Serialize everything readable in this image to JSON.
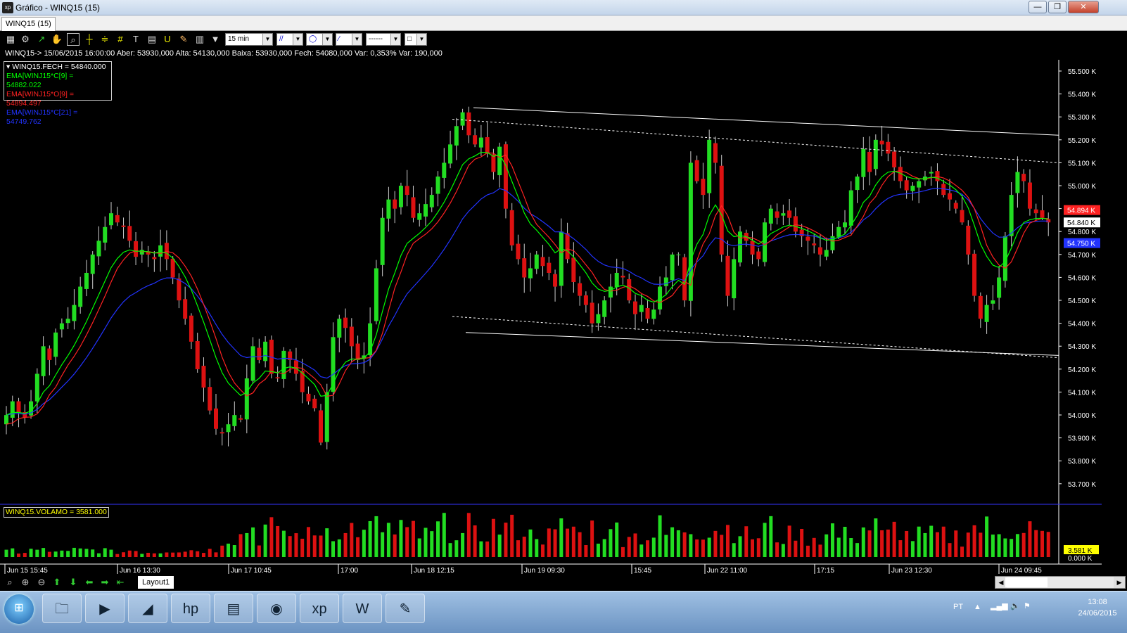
{
  "window": {
    "title": "Gráfico - WINQ15 (15)",
    "app_icon": "xp",
    "minimize": "—",
    "restore": "❐",
    "close": "✕"
  },
  "tab": {
    "label": "WINQ15 (15)"
  },
  "toolbar": {
    "interval": "15 min",
    "line_style": "------",
    "icons": [
      "chart-icon",
      "gear-icon",
      "cursor-icon",
      "hand-icon",
      "zoom-icon",
      "crosshair-icon",
      "fibonacci-icon",
      "grid-icon",
      "text-icon",
      "calculator-icon",
      "magnet-icon",
      "brush-icon",
      "trash-icon",
      "filter-icon"
    ]
  },
  "info_line": "WINQ15-> 15/06/2015 16:00:00 Aber: 53930,000 Alta: 54130,000 Baixa: 53930,000 Fech: 54080,000 Var: 0,353% Var: 190,000",
  "legend": [
    {
      "text": "▾ WINQ15.FECH = 54840.000",
      "color": "#ffffff"
    },
    {
      "text": "EMA[WINJ15*C[9] = 54882.022",
      "color": "#00ff00"
    },
    {
      "text": "EMA[WINJ15*O[9] = 54894.497",
      "color": "#ff2222"
    },
    {
      "text": "EMA[WINJ15*C[21] = 54749.762",
      "color": "#2233ff"
    }
  ],
  "volume_label": "WINQ15.VOLAMO = 3581.000",
  "price_axis": [
    "55.500 K",
    "55.400 K",
    "55.300 K",
    "55.200 K",
    "55.100 K",
    "55.000 K",
    "54.900 K",
    "54.800 K",
    "54.700 K",
    "54.600 K",
    "54.500 K",
    "54.400 K",
    "54.300 K",
    "54.200 K",
    "54.100 K",
    "54.000 K",
    "53.900 K",
    "53.800 K",
    "53.700 K"
  ],
  "price_tags": [
    {
      "text": "54.894 K",
      "value": 54894,
      "bg": "#ff2222",
      "fg": "#ffffff"
    },
    {
      "text": "54.840 K",
      "value": 54840,
      "bg": "#ffffff",
      "fg": "#000000"
    },
    {
      "text": "54.750 K",
      "value": 54750,
      "bg": "#2233ff",
      "fg": "#ffffff"
    }
  ],
  "volume_axis": {
    "tag": "3.581 K",
    "zero": "0.000 K"
  },
  "time_axis": [
    "Jun 15 15:45",
    "Jun 16 13:30",
    "Jun 17 10:45",
    "17:00",
    "Jun 18 12:15",
    "Jun 19 09:30",
    "15:45",
    "Jun 22 11:00",
    "17:15",
    "Jun 23 12:30",
    "Jun 24 09:45"
  ],
  "chart_data": {
    "type": "candlestick",
    "symbol": "WINQ15",
    "interval": "15 min",
    "ylim": [
      53600,
      55600
    ],
    "overlays": [
      "EMA C 9 (green)",
      "EMA O 9 (red)",
      "EMA C 21 (blue)"
    ],
    "closes": [
      54000,
      54060,
      54010,
      53990,
      54060,
      54180,
      54300,
      54240,
      54360,
      54400,
      54420,
      54480,
      54560,
      54620,
      54700,
      54760,
      54820,
      54880,
      54840,
      54820,
      54760,
      54690,
      54720,
      54700,
      54680,
      54740,
      54680,
      54600,
      54500,
      54420,
      54320,
      54200,
      54120,
      54020,
      53940,
      53920,
      53960,
      54000,
      53980,
      54160,
      54300,
      54240,
      54320,
      54180,
      54160,
      54280,
      54240,
      54180,
      54100,
      54060,
      54030,
      53880,
      54100,
      54340,
      54420,
      54380,
      54300,
      54240,
      54260,
      54400,
      54640,
      54860,
      54940,
      54900,
      55000,
      54960,
      54860,
      54880,
      54920,
      54960,
      55040,
      55100,
      55180,
      55260,
      55320,
      55220,
      55180,
      55210,
      55140,
      55060,
      55170,
      54900,
      54740,
      54680,
      54600,
      54640,
      54700,
      54650,
      54620,
      54560,
      54800,
      54680,
      54580,
      54520,
      54480,
      54400,
      54440,
      54500,
      54560,
      54620,
      54600,
      54500,
      54440,
      54480,
      54420,
      54460,
      54560,
      54600,
      54700,
      54700,
      54500,
      55100,
      55020,
      54960,
      55200,
      55100,
      54700,
      54520,
      54680,
      54800,
      54760,
      54700,
      54680,
      54840,
      54900,
      54860,
      54880,
      54860,
      54800,
      54780,
      54760,
      54740,
      54700,
      54720,
      54780,
      54820,
      54840,
      54980,
      55040,
      55160,
      55060,
      55200,
      55180,
      55140,
      55080,
      55020,
      54980,
      55000,
      55020,
      55040,
      55060,
      55020,
      54960,
      54940,
      54900,
      54840,
      54700,
      54520,
      54420,
      54480,
      54500,
      54600,
      54780,
      54960,
      55060,
      55020,
      54900,
      54880,
      54860,
      54840
    ],
    "volume_max": 3581,
    "range_lines": [
      {
        "style": "solid",
        "from": {
          "t": "Jun 18 14:00",
          "y": 55340
        },
        "to": {
          "t": "Jun 24 end",
          "y": 55220
        }
      },
      {
        "style": "dashed",
        "from": {
          "t": "Jun 18 13:30",
          "y": 55290
        },
        "to": {
          "t": "Jun 24 end",
          "y": 55100
        }
      },
      {
        "style": "dashed",
        "from": {
          "t": "Jun 18 13:30",
          "y": 54430
        },
        "to": {
          "t": "Jun 24 end",
          "y": 54250
        }
      },
      {
        "style": "solid",
        "from": {
          "t": "Jun 18 14:00",
          "y": 54360
        },
        "to": {
          "t": "Jun 24 end",
          "y": 54260
        }
      }
    ]
  },
  "taskbar": {
    "apps": [
      "explorer-icon",
      "media-player-icon",
      "network-icon",
      "hp-icon",
      "presentation-icon",
      "chrome-icon",
      "xp-icon",
      "word-icon",
      "paint-icon"
    ],
    "app_glyphs": [
      "🗀",
      "▶",
      "◢",
      "hp",
      "▤",
      "◉",
      "xp",
      "W",
      "✎"
    ],
    "lang": "PT",
    "time": "13:08",
    "date": "24/06/2015"
  }
}
